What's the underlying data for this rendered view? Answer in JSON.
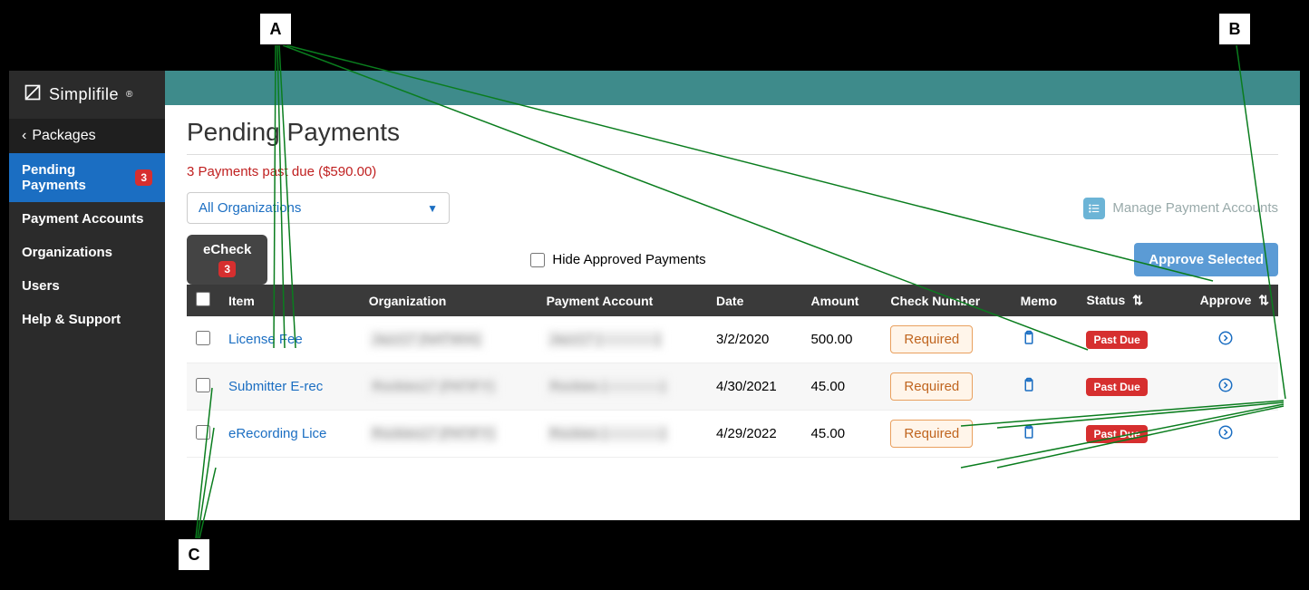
{
  "annotations": {
    "a": "A",
    "b": "B",
    "c": "C"
  },
  "brand": "Simplifile",
  "nav": {
    "back": "Packages",
    "items": [
      {
        "label": "Pending Payments",
        "badge": "3",
        "active": true
      },
      {
        "label": "Payment Accounts"
      },
      {
        "label": "Organizations"
      },
      {
        "label": "Users"
      },
      {
        "label": "Help & Support"
      }
    ]
  },
  "page": {
    "title": "Pending Payments",
    "alert": "3 Payments past due ($590.00)",
    "org_filter": "All Organizations",
    "manage_link": "Manage Payment Accounts",
    "tab_label": "eCheck",
    "tab_badge": "3",
    "hide_approved_label": "Hide Approved Payments",
    "approve_button": "Approve Selected"
  },
  "table": {
    "headers": {
      "item": "Item",
      "organization": "Organization",
      "payment_account": "Payment Account",
      "date": "Date",
      "amount": "Amount",
      "check_number": "Check Number",
      "memo": "Memo",
      "status": "Status",
      "approve": "Approve"
    },
    "rows": [
      {
        "item": "License Fee",
        "org": "Jazz17 (NATWIA)",
        "account": "Jazz17 (————)",
        "date": "3/2/2020",
        "amount": "500.00",
        "check": "Required",
        "status": "Past Due"
      },
      {
        "item": "Submitter E-rec",
        "org": "Rockies17 (PATIFY)",
        "account": "Rockies (————)",
        "date": "4/30/2021",
        "amount": "45.00",
        "check": "Required",
        "status": "Past Due"
      },
      {
        "item": "eRecording Lice",
        "org": "Rockies17 (PATIFY)",
        "account": "Rockies (————)",
        "date": "4/29/2022",
        "amount": "45.00",
        "check": "Required",
        "status": "Past Due"
      }
    ]
  }
}
